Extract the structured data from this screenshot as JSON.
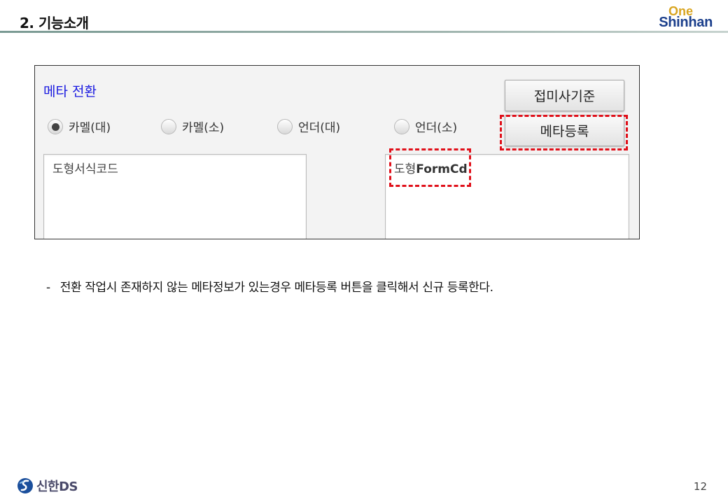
{
  "header": {
    "section_title": "2. 기능소개",
    "logo_top": "One",
    "logo_bottom": "Shinhan"
  },
  "panel": {
    "title": "메타 전환",
    "buttons": {
      "base_label": "접미사기준",
      "register_label": "메타등록"
    },
    "radios": [
      {
        "label": "카멜(대)",
        "checked": true
      },
      {
        "label": "카멜(소)",
        "checked": false
      },
      {
        "label": "언더(대)",
        "checked": false
      },
      {
        "label": "언더(소)",
        "checked": false
      }
    ],
    "input_left": "도형서식코드",
    "input_right_prefix": "도형",
    "input_right_suffix": "FormCd"
  },
  "description": {
    "dash": "-",
    "text": "전환 작업시 존재하지 않는 메타정보가 있는경우 메타등록 버튼을 클릭해서 신규 등록한다."
  },
  "footer": {
    "company": "신한DS",
    "page_number": "12"
  },
  "colors": {
    "highlight": "#e0101a",
    "panel_title": "#1a1ae0",
    "logo_gold": "#d9a520",
    "logo_blue": "#1b3f8c"
  }
}
